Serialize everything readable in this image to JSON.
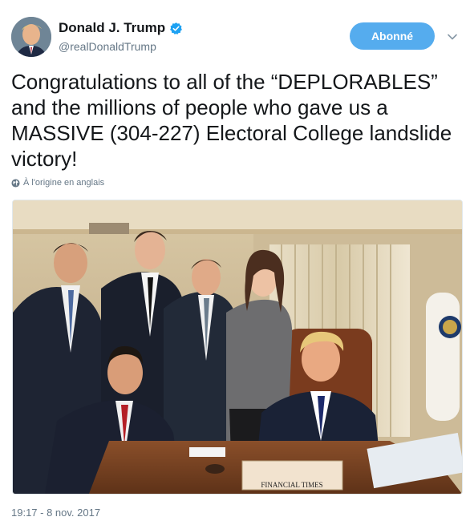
{
  "header": {
    "display_name": "Donald J. Trump",
    "handle": "@realDonaldTrump",
    "follow_label": "Abonné"
  },
  "tweet": {
    "text": "Congratulations to all of the “DEPLORABLES” and the millions of people who gave us a MASSIVE (304-227) Electoral College landslide victory!",
    "translate_note": "À l'origine en anglais",
    "photo_caption_newspaper": "FINANCIAL TIMES",
    "timestamp": "19:17 - 8 nov. 2017"
  },
  "colors": {
    "accent": "#55acee",
    "verified": "#1da1f2",
    "secondary_text": "#657786"
  },
  "icons": {
    "verified": "verified-badge-icon",
    "caret": "chevron-down-icon",
    "globe": "globe-icon"
  }
}
